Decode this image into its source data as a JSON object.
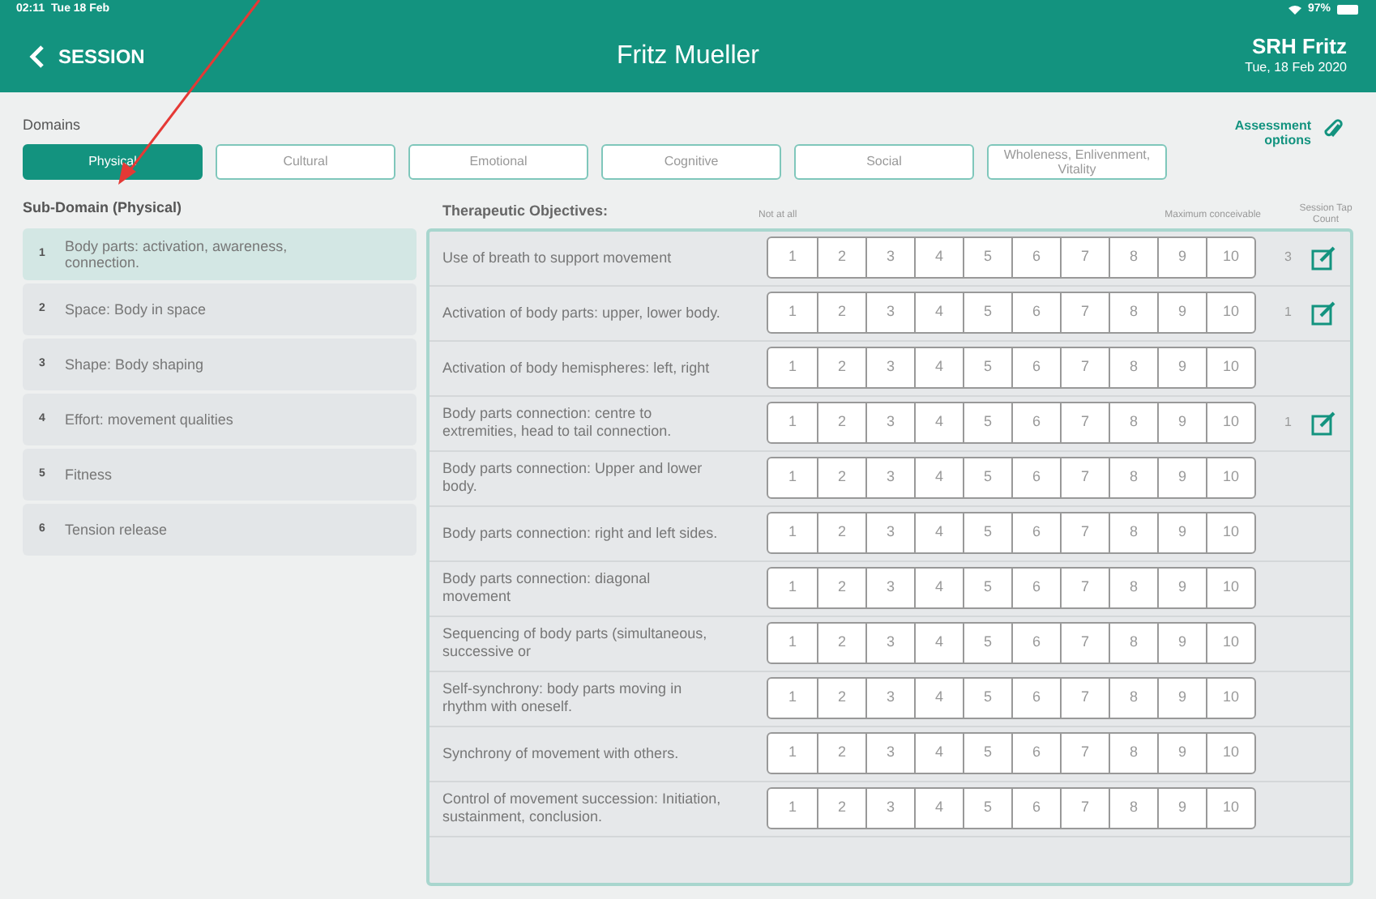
{
  "status_bar": {
    "time": "02:11",
    "date": "Tue 18 Feb",
    "battery": "97%"
  },
  "header": {
    "back": "SESSION",
    "title": "Fritz Mueller",
    "user": "SRH Fritz",
    "date": "Tue, 18 Feb 2020"
  },
  "domains": {
    "label": "Domains",
    "tabs": [
      {
        "label": "Physical",
        "selected": true
      },
      {
        "label": "Cultural",
        "selected": false
      },
      {
        "label": "Emotional",
        "selected": false
      },
      {
        "label": "Cognitive",
        "selected": false
      },
      {
        "label": "Social",
        "selected": false
      },
      {
        "label": "Wholeness, Enlivenment, Vitality",
        "selected": false
      }
    ]
  },
  "assessment_options": "Assessment options",
  "sub_domains": {
    "heading": "Sub-Domain (Physical)",
    "items": [
      {
        "number": "1",
        "label": "Body parts: activation, awareness, connection.",
        "selected": true
      },
      {
        "number": "2",
        "label": "Space: Body in space",
        "selected": false
      },
      {
        "number": "3",
        "label": "Shape: Body shaping",
        "selected": false
      },
      {
        "number": "4",
        "label": "Effort: movement qualities",
        "selected": false
      },
      {
        "number": "5",
        "label": "Fitness",
        "selected": false
      },
      {
        "number": "6",
        "label": "Tension release",
        "selected": false
      }
    ]
  },
  "objectives": {
    "heading": "Therapeutic Objectives:",
    "scale_min": "Not at all",
    "scale_max": "Maximum conceivable",
    "count_heading": "Session Tap Count",
    "rows": [
      {
        "label": "Use of breath to support movement",
        "scale": [
          "1",
          "2",
          "3",
          "4",
          "5",
          "6",
          "7",
          "8",
          "9",
          "10"
        ],
        "tap_count": "3"
      },
      {
        "label": "Activation of body parts: upper, lower body.",
        "scale": [
          "1",
          "2",
          "3",
          "4",
          "5",
          "6",
          "7",
          "8",
          "9",
          "10"
        ],
        "tap_count": "1"
      },
      {
        "label": "Activation of body hemispheres: left, right",
        "scale": [
          "1",
          "2",
          "3",
          "4",
          "5",
          "6",
          "7",
          "8",
          "9",
          "10"
        ]
      },
      {
        "label": "Body parts connection: centre to extremities, head to tail connection.",
        "scale": [
          "1",
          "2",
          "3",
          "4",
          "5",
          "6",
          "7",
          "8",
          "9",
          "10"
        ],
        "tap_count": "1"
      },
      {
        "label": "Body parts connection: Upper and lower body.",
        "scale": [
          "1",
          "2",
          "3",
          "4",
          "5",
          "6",
          "7",
          "8",
          "9",
          "10"
        ]
      },
      {
        "label": "Body parts connection: right and left sides.",
        "scale": [
          "1",
          "2",
          "3",
          "4",
          "5",
          "6",
          "7",
          "8",
          "9",
          "10"
        ]
      },
      {
        "label": "Body parts connection: diagonal movement",
        "scale": [
          "1",
          "2",
          "3",
          "4",
          "5",
          "6",
          "7",
          "8",
          "9",
          "10"
        ]
      },
      {
        "label": "Sequencing of body parts (simultaneous, successive or",
        "scale": [
          "1",
          "2",
          "3",
          "4",
          "5",
          "6",
          "7",
          "8",
          "9",
          "10"
        ]
      },
      {
        "label": "Self-synchrony: body parts moving in rhythm with oneself.",
        "scale": [
          "1",
          "2",
          "3",
          "4",
          "5",
          "6",
          "7",
          "8",
          "9",
          "10"
        ]
      },
      {
        "label": "Synchrony of movement with others.",
        "scale": [
          "1",
          "2",
          "3",
          "4",
          "5",
          "6",
          "7",
          "8",
          "9",
          "10"
        ]
      },
      {
        "label": "Control of movement succession: Initiation, sustainment, conclusion.",
        "scale": [
          "1",
          "2",
          "3",
          "4",
          "5",
          "6",
          "7",
          "8",
          "9",
          "10"
        ]
      }
    ]
  }
}
